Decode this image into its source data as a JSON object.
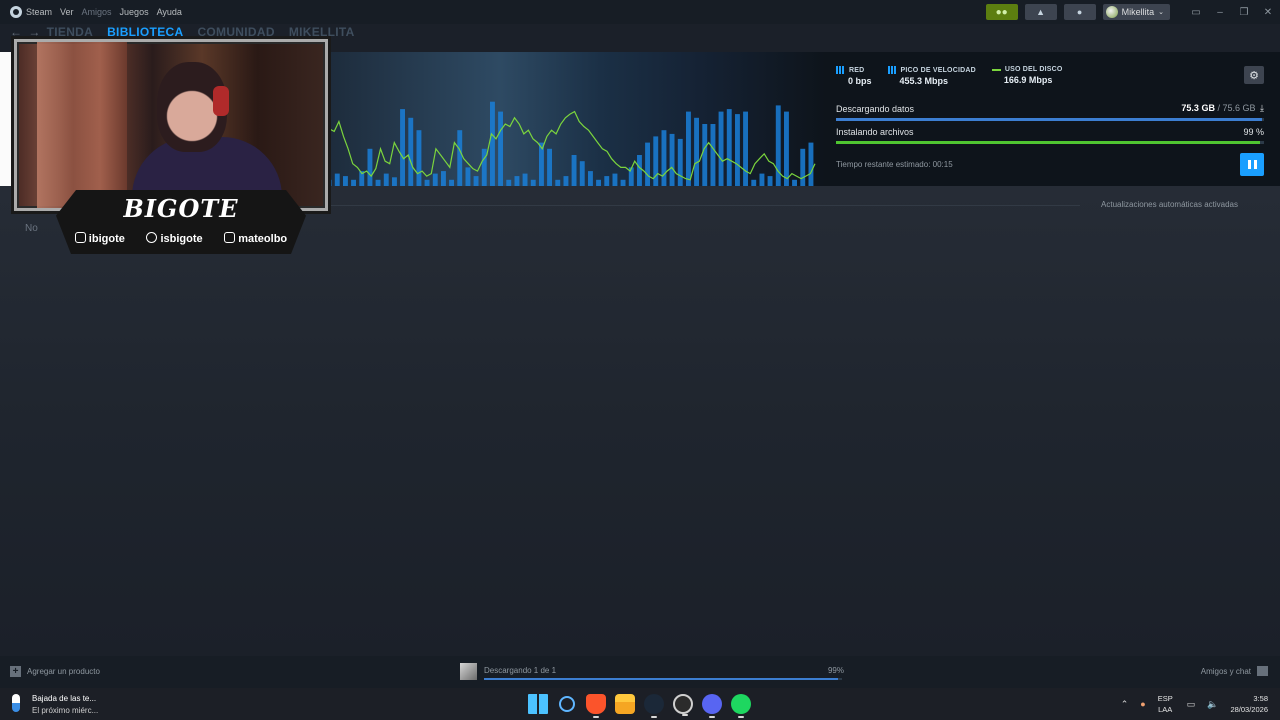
{
  "menu": {
    "app_name": "Steam",
    "items": [
      "Ver",
      "Amigos",
      "Juegos",
      "Ayuda"
    ],
    "username": "Mikellita"
  },
  "nav": {
    "tabs": [
      "TIENDA",
      "BIBLIOTECA",
      "COMUNIDAD",
      "MIKELLITA"
    ],
    "active": "BIBLIOTECA"
  },
  "downloads": {
    "stats": [
      {
        "label": "RED",
        "value": "0 bps"
      },
      {
        "label": "PICO DE VELOCIDAD",
        "value": "455.3 Mbps"
      },
      {
        "label": "USO DEL DISCO",
        "value": "166.9 Mbps"
      }
    ],
    "download_label": "Descargando datos",
    "download_size": "75.3 GB",
    "download_total": "/ 75.6 GB",
    "download_progress": 0.996,
    "install_label": "Instalando archivos",
    "install_pct": "99 %",
    "install_progress": 0.99,
    "time_remaining": "Tiempo restante estimado: 00:15",
    "network_bars": [
      0.05,
      0.1,
      0.08,
      0.05,
      0.12,
      0.3,
      0.05,
      0.1,
      0.07,
      0.62,
      0.55,
      0.45,
      0.05,
      0.1,
      0.12,
      0.05,
      0.45,
      0.15,
      0.08,
      0.3,
      0.68,
      0.6,
      0.05,
      0.08,
      0.1,
      0.05,
      0.35,
      0.3,
      0.05,
      0.08,
      0.25,
      0.2,
      0.12,
      0.05,
      0.08,
      0.1,
      0.05,
      0.15,
      0.25,
      0.35,
      0.4,
      0.45,
      0.42,
      0.38,
      0.6,
      0.55,
      0.5,
      0.5,
      0.6,
      0.62,
      0.58,
      0.6,
      0.05,
      0.1,
      0.08,
      0.65,
      0.6,
      0.05,
      0.3,
      0.35
    ],
    "disk_line": [
      0.42,
      0.46,
      0.44,
      0.52,
      0.4,
      0.3,
      0.18,
      0.15,
      0.1,
      0.12,
      0.08,
      0.14,
      0.3,
      0.2,
      0.18,
      0.35,
      0.28,
      0.22,
      0.25,
      0.15,
      0.1,
      0.12,
      0.08,
      0.1,
      0.3,
      0.25,
      0.2,
      0.15,
      0.35,
      0.3,
      0.22,
      0.18,
      0.14,
      0.12,
      0.2,
      0.25,
      0.42,
      0.38,
      0.45,
      0.5,
      0.48,
      0.55,
      0.5,
      0.42,
      0.45,
      0.38,
      0.35,
      0.3,
      0.4,
      0.45,
      0.42,
      0.5,
      0.55,
      0.58,
      0.6,
      0.52,
      0.48,
      0.45,
      0.4,
      0.35,
      0.3,
      0.28,
      0.22,
      0.18,
      0.15,
      0.15,
      0.12,
      0.2,
      0.15,
      0.12,
      0.08,
      0.06,
      0.1,
      0.08,
      0.12,
      0.15,
      0.1,
      0.08,
      0.06,
      0.05,
      0.18,
      0.2,
      0.3,
      0.35,
      0.3,
      0.25,
      0.2,
      0.22,
      0.2,
      0.18,
      0.15,
      0.12,
      0.1,
      0.18,
      0.22,
      0.26,
      0.2,
      0.18,
      0.12,
      0.08,
      0.06,
      0.1,
      0.08,
      0.06,
      0.08,
      0.1,
      0.18
    ]
  },
  "content": {
    "auto_updates": "Actualizaciones automáticas activadas",
    "no_text": "No"
  },
  "overlay": {
    "brand": "BIGOTE",
    "socials": [
      {
        "icon": "twitch-kick-icon",
        "handle": "ibigote"
      },
      {
        "icon": "tiktok-icon",
        "handle": "isbigote"
      },
      {
        "icon": "instagram-icon",
        "handle": "mateolbo"
      }
    ]
  },
  "statusbar": {
    "add_product": "Agregar un producto",
    "downloading": "Descargando 1 de 1",
    "downloading_pct": "99%",
    "downloading_progress": 0.99,
    "friends_chat": "Amigos y chat"
  },
  "taskbar": {
    "weather_title": "Bajada de las te...",
    "weather_sub": "El próximo miérc...",
    "lang_top": "ESP",
    "lang_bottom": "LAA",
    "time": "3:58",
    "date": "28/03/2026",
    "apps": [
      "windows-icon",
      "search-icon",
      "brave-icon",
      "file-explorer-icon",
      "steam-icon",
      "obs-icon",
      "discord-icon",
      "spotify-icon"
    ]
  },
  "colors": {
    "accent_blue": "#1a9fff",
    "download_bar": "#3c7ed1",
    "install_bar": "#4fc531",
    "disk_line": "#7bd53d",
    "net_bars": "#1a7fd8"
  }
}
